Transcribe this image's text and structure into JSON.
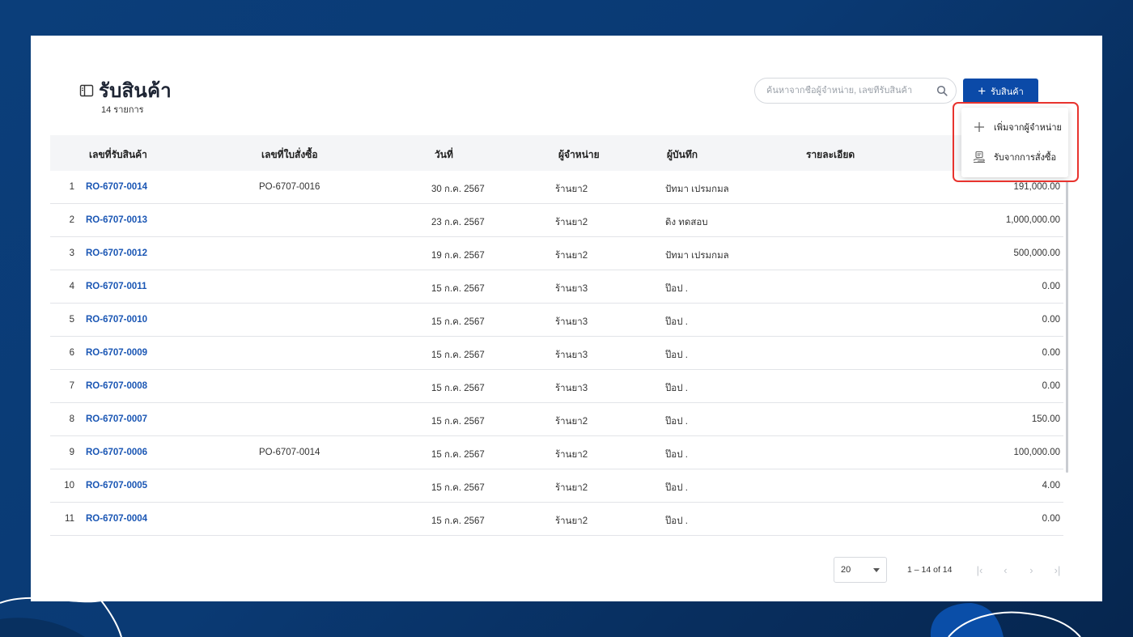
{
  "header": {
    "title": "รับสินค้า",
    "subtitle": "14 รายการ",
    "title_icon": "sidebar-panel-icon"
  },
  "search": {
    "placeholder": "ค้นหาจากชื่อผู้จำหน่าย, เลขที่รับสินค้า",
    "icon": "search-icon"
  },
  "actions": {
    "receive_label": "รับสินค้า",
    "receive_icon": "plus-icon"
  },
  "menu": {
    "items": [
      {
        "label": "เพิ่มจากผู้จำหน่าย",
        "icon": "plus-icon"
      },
      {
        "label": "รับจากการสั่งซื้อ",
        "icon": "order-hand-icon"
      }
    ]
  },
  "table": {
    "columns": [
      "เลขที่รับสินค้า",
      "เลขที่ใบสั่งซื้อ",
      "วันที่",
      "ผู้จำหน่าย",
      "ผู้บันทึก",
      "รายละเอียด"
    ],
    "rows": [
      {
        "idx": "1",
        "receipt": "RO-6707-0014",
        "po": "PO-6707-0016",
        "date": "30 ก.ค. 2567",
        "supplier": "ร้านยา2",
        "recorder": "ปัทมา เปรมกมล",
        "amount": "191,000.00"
      },
      {
        "idx": "2",
        "receipt": "RO-6707-0013",
        "po": "",
        "date": "23 ก.ค. 2567",
        "supplier": "ร้านยา2",
        "recorder": "ดิง ทดสอบ",
        "amount": "1,000,000.00"
      },
      {
        "idx": "3",
        "receipt": "RO-6707-0012",
        "po": "",
        "date": "19 ก.ค. 2567",
        "supplier": "ร้านยา2",
        "recorder": "ปัทมา เปรมกมล",
        "amount": "500,000.00"
      },
      {
        "idx": "4",
        "receipt": "RO-6707-0011",
        "po": "",
        "date": "15 ก.ค. 2567",
        "supplier": "ร้านยา3",
        "recorder": "ป๊อป .",
        "amount": "0.00"
      },
      {
        "idx": "5",
        "receipt": "RO-6707-0010",
        "po": "",
        "date": "15 ก.ค. 2567",
        "supplier": "ร้านยา3",
        "recorder": "ป๊อป .",
        "amount": "0.00"
      },
      {
        "idx": "6",
        "receipt": "RO-6707-0009",
        "po": "",
        "date": "15 ก.ค. 2567",
        "supplier": "ร้านยา3",
        "recorder": "ป๊อป .",
        "amount": "0.00"
      },
      {
        "idx": "7",
        "receipt": "RO-6707-0008",
        "po": "",
        "date": "15 ก.ค. 2567",
        "supplier": "ร้านยา3",
        "recorder": "ป๊อป .",
        "amount": "0.00"
      },
      {
        "idx": "8",
        "receipt": "RO-6707-0007",
        "po": "",
        "date": "15 ก.ค. 2567",
        "supplier": "ร้านยา2",
        "recorder": "ป๊อป .",
        "amount": "150.00"
      },
      {
        "idx": "9",
        "receipt": "RO-6707-0006",
        "po": "PO-6707-0014",
        "date": "15 ก.ค. 2567",
        "supplier": "ร้านยา2",
        "recorder": "ป๊อป .",
        "amount": "100,000.00"
      },
      {
        "idx": "10",
        "receipt": "RO-6707-0005",
        "po": "",
        "date": "15 ก.ค. 2567",
        "supplier": "ร้านยา2",
        "recorder": "ป๊อป .",
        "amount": "4.00"
      },
      {
        "idx": "11",
        "receipt": "RO-6707-0004",
        "po": "",
        "date": "15 ก.ค. 2567",
        "supplier": "ร้านยา2",
        "recorder": "ป๊อป .",
        "amount": "0.00"
      }
    ]
  },
  "pagination": {
    "page_size": "20",
    "range": "1 – 14 of 14"
  },
  "colors": {
    "background": "#0a3a74",
    "primary": "#0b4aa8",
    "link": "#1a56b4",
    "highlight": "#e8332e"
  }
}
